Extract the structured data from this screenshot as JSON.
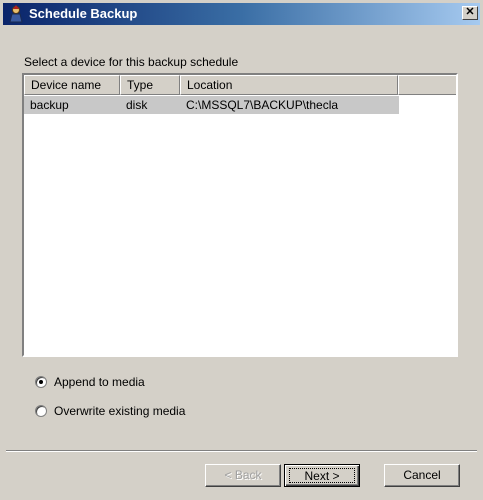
{
  "window": {
    "title": "Schedule Backup",
    "title_icon": "wizard-figure-icon",
    "close_glyph": "✕"
  },
  "prompt": "Select a device for this backup schedule",
  "devices": {
    "columns": [
      "Device name",
      "Type",
      "Location"
    ],
    "rows": [
      {
        "name": "backup",
        "type": "disk",
        "location": "C:\\MSSQL7\\BACKUP\\thecla",
        "selected": true
      }
    ]
  },
  "options": {
    "append": {
      "label": "Append to media",
      "checked": true
    },
    "overwrite": {
      "label": "Overwrite existing media",
      "checked": false
    }
  },
  "buttons": {
    "back": "< Back",
    "next": "Next >",
    "cancel": "Cancel"
  },
  "colors": {
    "title_start": "#0a246a",
    "title_end": "#a6caf0",
    "face": "#d4d0c8",
    "selection": "#c8c8c8"
  }
}
